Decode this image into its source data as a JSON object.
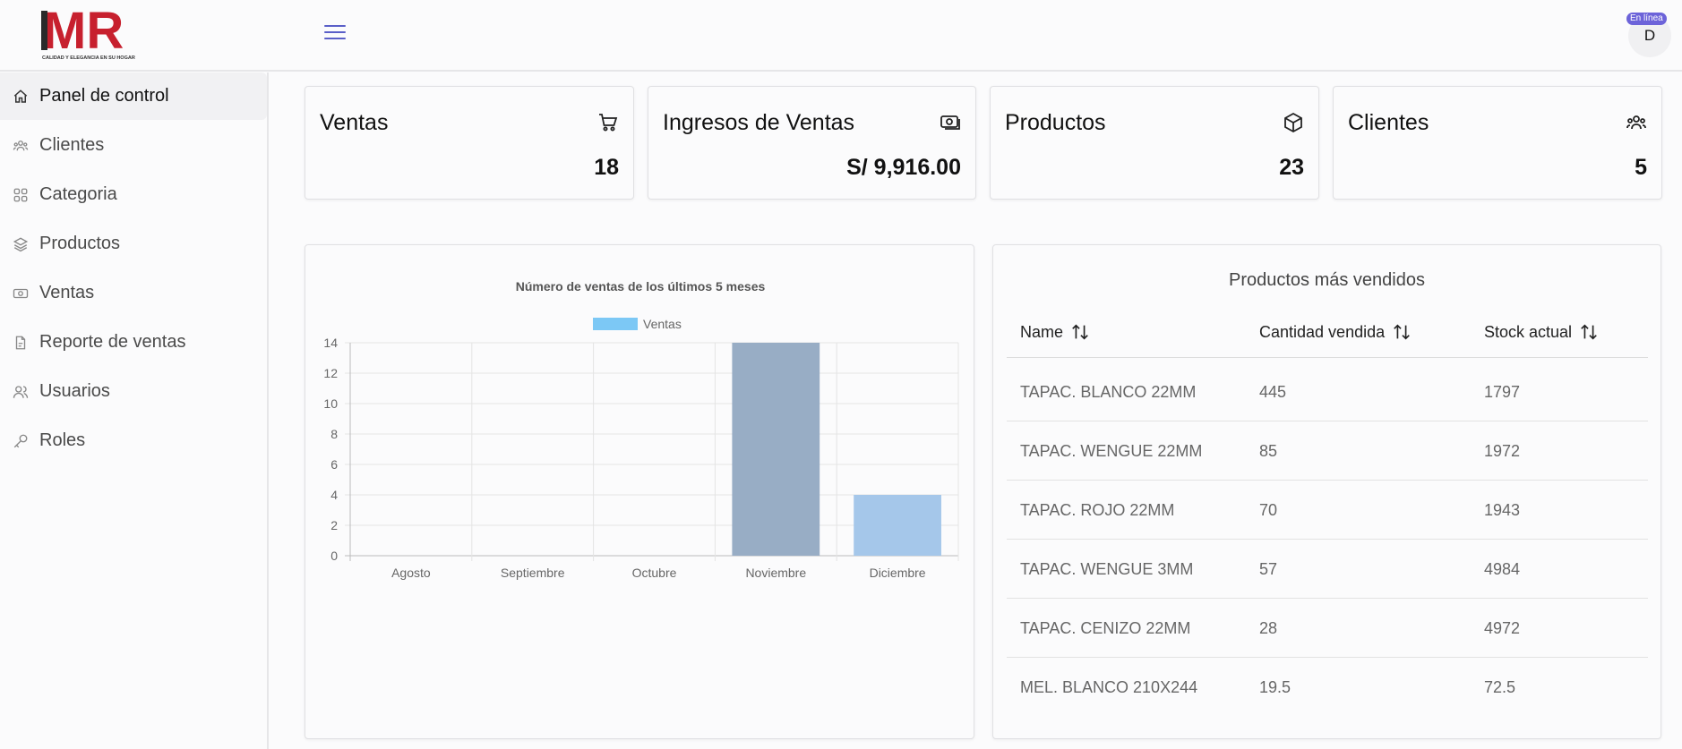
{
  "header": {
    "logo_text": "MR",
    "logo_tagline": "CALIDAD Y ELEGANCIA EN SU HOGAR",
    "menu_icon": "hamburger-icon",
    "avatar_initial": "D",
    "status_badge": "En línea",
    "colors": {
      "brand_red": "#c7202e",
      "accent": "#5a5fc8",
      "badge": "#6c63d9"
    }
  },
  "sidebar": {
    "items": [
      {
        "label": "Panel de control",
        "icon": "home-icon",
        "active": true
      },
      {
        "label": "Clientes",
        "icon": "users-group-icon",
        "active": false
      },
      {
        "label": "Categoria",
        "icon": "grid-icon",
        "active": false
      },
      {
        "label": "Productos",
        "icon": "layers-icon",
        "active": false
      },
      {
        "label": "Ventas",
        "icon": "cash-icon",
        "active": false
      },
      {
        "label": "Reporte de ventas",
        "icon": "file-report-icon",
        "active": false
      },
      {
        "label": "Usuarios",
        "icon": "users-icon",
        "active": false
      },
      {
        "label": "Roles",
        "icon": "key-icon",
        "active": false
      }
    ]
  },
  "cards": [
    {
      "title": "Ventas",
      "value": "18",
      "icon": "cart-icon"
    },
    {
      "title": "Ingresos de Ventas",
      "value": "S/ 9,916.00",
      "icon": "money-icon"
    },
    {
      "title": "Productos",
      "value": "23",
      "icon": "box-icon"
    },
    {
      "title": "Clientes",
      "value": "5",
      "icon": "users-group-icon"
    }
  ],
  "chart_data": {
    "type": "bar",
    "title": "Número de ventas de los últimos 5 meses",
    "categories": [
      "Agosto",
      "Septiembre",
      "Octubre",
      "Noviembre",
      "Diciembre"
    ],
    "series": [
      {
        "name": "Ventas",
        "values": [
          0,
          0,
          0,
          14,
          4
        ]
      }
    ],
    "bar_colors": [
      "#98adc5",
      "#98adc5",
      "#98adc5",
      "#98adc5",
      "#a5c7ea"
    ],
    "legend_color": "#7cc8f5",
    "ylim": [
      0,
      14
    ],
    "yticks": [
      "0",
      "2",
      "4",
      "6",
      "8",
      "10",
      "12",
      "14"
    ],
    "grid": true,
    "legend_position": "top"
  },
  "top_products": {
    "title": "Productos más vendidos",
    "columns": [
      "Name",
      "Cantidad vendida",
      "Stock actual"
    ],
    "rows": [
      [
        "TAPAC. BLANCO 22MM",
        "445",
        "1797"
      ],
      [
        "TAPAC. WENGUE 22MM",
        "85",
        "1972"
      ],
      [
        "TAPAC. ROJO 22MM",
        "70",
        "1943"
      ],
      [
        "TAPAC. WENGUE 3MM",
        "57",
        "4984"
      ],
      [
        "TAPAC. CENIZO 22MM",
        "28",
        "4972"
      ],
      [
        "MEL. BLANCO 210X244",
        "19.5",
        "72.5"
      ]
    ]
  }
}
